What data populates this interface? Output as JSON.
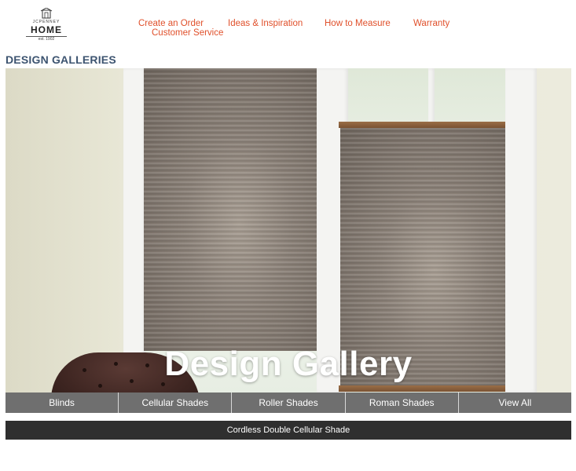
{
  "header": {
    "logo": {
      "brand_top": "JCPENNEY",
      "brand_main": "HOME",
      "established": "est. 1902"
    },
    "nav": [
      {
        "label": "Create an Order"
      },
      {
        "label": "Ideas & Inspiration"
      },
      {
        "label": "How to Measure"
      },
      {
        "label": "Warranty"
      },
      {
        "label": "Customer Service"
      }
    ],
    "link_color": "#e0502b"
  },
  "page": {
    "section_title": "DESIGN GALLERIES",
    "section_title_color": "#3d5470"
  },
  "hero": {
    "heading": "Design Gallery",
    "categories": [
      {
        "label": "Blinds"
      },
      {
        "label": "Cellular Shades"
      },
      {
        "label": "Roller Shades"
      },
      {
        "label": "Roman Shades"
      },
      {
        "label": "View All"
      }
    ],
    "caption": "Cordless Double Cellular Shade"
  }
}
